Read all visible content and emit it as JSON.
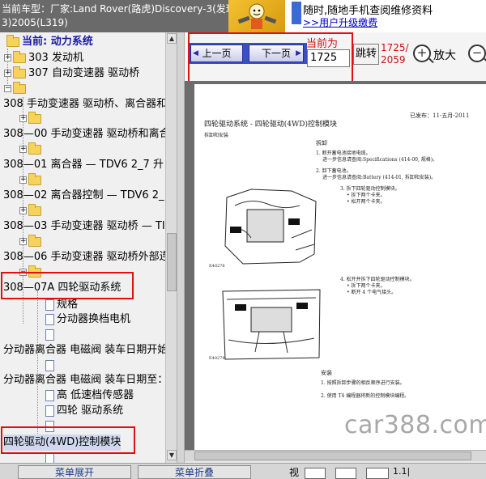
{
  "title": {
    "line1": "当前车型：厂家:Land Rover(路虎)Discovery-3(发现",
    "line2": "3)2005(L319)"
  },
  "banner": {
    "line1": "随时,随地手机查阅维修资料",
    "line2": ">>用户升级缴费"
  },
  "tree": {
    "current_label": "当前: 动力系统",
    "items": [
      {
        "label": "303 发动机"
      },
      {
        "label": "307 自动变速器 驱动桥"
      },
      {
        "label": "308 手动变速器 驱动桥、离合器和"
      },
      {
        "label": "308—00 手动变速器 驱动桥和离合"
      },
      {
        "label": "308—01 离合器 — TDV6 2_7 升"
      },
      {
        "label": "308—02 离合器控制 — TDV6 2_"
      },
      {
        "label": "308—03 手动变速器 驱动桥 — TI"
      },
      {
        "label": "308—06 手动变速器 驱动桥外部连"
      },
      {
        "label": "308—07A 四轮驱动系统"
      },
      {
        "label": "规格"
      },
      {
        "label": "分动器换档电机"
      },
      {
        "label": "分动器离合器 电磁阀 装车日期开始"
      },
      {
        "label": "分动器离合器 电磁阀 装车日期至："
      },
      {
        "label": "高 低速档传感器"
      },
      {
        "label": "四轮 驱动系统"
      },
      {
        "label": "四轮驱动(4WD)控制模块"
      }
    ]
  },
  "viewer": {
    "prev_label": "上一页",
    "next_label": "下一页",
    "current_label": "当前为",
    "page_value": "1725",
    "jump_label": "跳转",
    "page_count": "1725/\n2059",
    "zoom_in_label": "放大",
    "zoom_in_symbol": "+",
    "zoom_out_symbol": "−"
  },
  "page": {
    "code": "已发布：11-五月-2011",
    "heading": "四轮驱动系统 - 四轮驱动(4WD)控制模块",
    "sub": "拆卸和安装",
    "removal": "拆卸",
    "s1": "1. 断开蓄电池接地电缆。",
    "s1b": "进一步信息请查阅:Specifications (414-00, 规格)。",
    "s2": "2. 卸下蓄电池。",
    "s2b": "进一步信息请查阅:Battery (414-01, 拆卸和安装)。",
    "s3": "3. 拆下四轮驱动控制模块。",
    "s3a": "• 拆下两个卡夹。",
    "s3b": "• 松开两个卡夹。",
    "fig1": "E40278",
    "s4": "4. 松开并拆下四轮驱动控制模块。",
    "s4a": "• 拆下两个卡夹。",
    "s4b": "• 断开 4 个电气接头。",
    "fig2": "E40279",
    "install": "安装",
    "i1": "1. 按照拆卸步骤的相反顺序进行安装。",
    "i2": "2. 使用 T4 编程器将新的控制模块编程。"
  },
  "watermark": "car388.com",
  "bottom": {
    "btn1": "菜单展开",
    "btn2": "菜单折叠",
    "view_label": "视",
    "ratio": "1.1|"
  },
  "colors": {
    "highlight": "#e01010",
    "nav_blue": "#3a4fc0"
  }
}
